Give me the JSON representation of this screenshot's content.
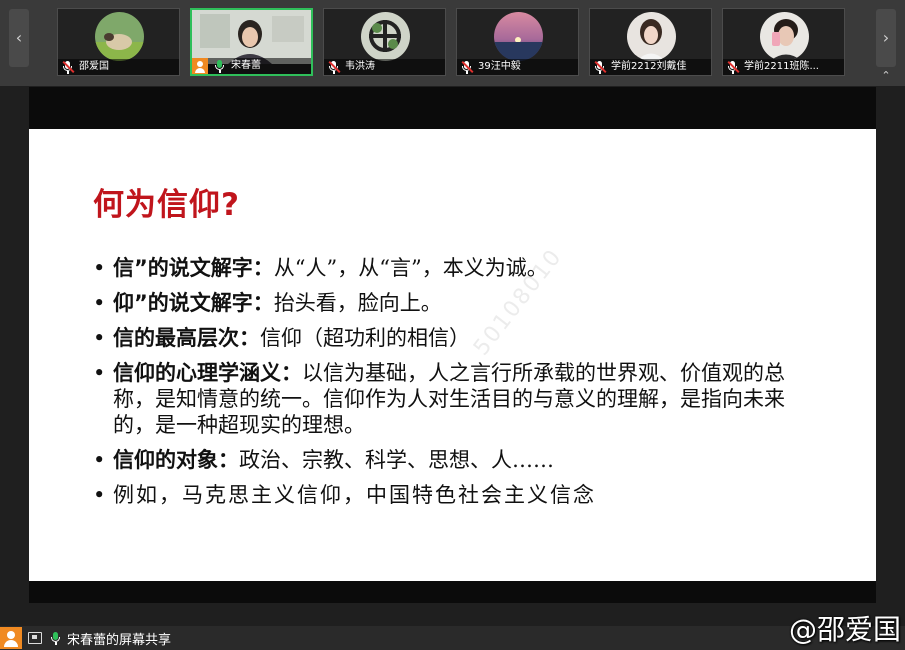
{
  "participants": [
    {
      "name": "邵爱国",
      "muted": true,
      "host": false,
      "avatar": "sheep"
    },
    {
      "name": "宋春蕾",
      "muted": false,
      "host": true,
      "avatar": "video"
    },
    {
      "name": "韦洪涛",
      "muted": true,
      "host": false,
      "avatar": "clover"
    },
    {
      "name": "39汪中毅",
      "muted": true,
      "host": false,
      "avatar": "sunset"
    },
    {
      "name": "学前2212刘戴佳",
      "muted": true,
      "host": false,
      "avatar": "girl"
    },
    {
      "name": "学前2211班陈...",
      "muted": true,
      "host": false,
      "avatar": "selfie"
    }
  ],
  "slide": {
    "title": "何为信仰?",
    "bullets": [
      {
        "head": "信”的说文解字：",
        "body": "从“人”，从“言”，本义为诚。"
      },
      {
        "head": "仰”的说文解字：",
        "body": "抬头看，脸向上。"
      },
      {
        "head": "信的最高层次：",
        "body": "信仰（超功利的相信）"
      },
      {
        "head": "信仰的心理学涵义：",
        "body": "以信为基础，人之言行所承载的世界观、价值观的总称，是知情意的统一。信仰作为人对生活目的与意义的理解，是指向未来的，是一种超现实的理想。"
      },
      {
        "head": "信仰的对象：",
        "body": "政治、宗教、科学、思想、人……"
      },
      {
        "head": "",
        "body": "例如，马克思主义信仰，中国特色社会主义信念"
      }
    ],
    "watermark": "50108010"
  },
  "share_status": "宋春蕾的屏幕共享",
  "corner_watermark": "@邵爱国",
  "colors": {
    "title": "#c0151c",
    "active_border": "#2fbf5a",
    "host_badge": "#f08a22",
    "mic_active": "#2fbf5a",
    "mic_muted": "#e0302e"
  }
}
